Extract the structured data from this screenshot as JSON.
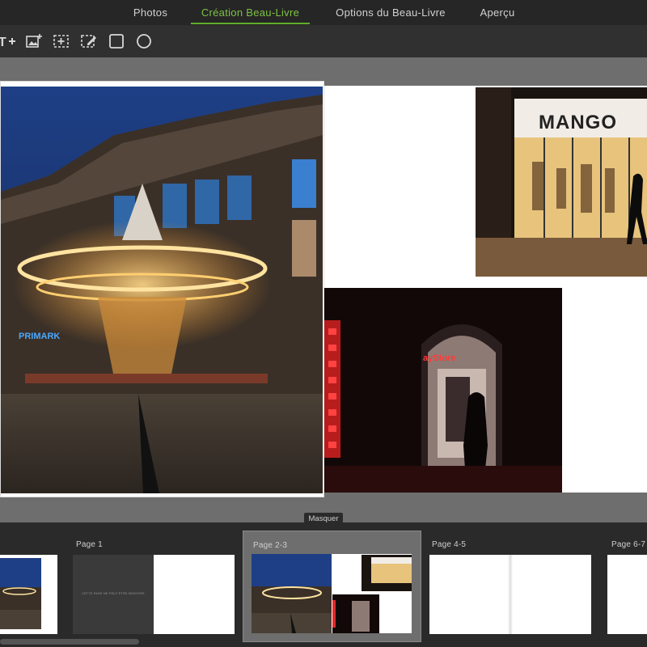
{
  "nav": {
    "tabs": [
      {
        "label": "Photos",
        "active": false
      },
      {
        "label": "Création Beau-Livre",
        "active": true
      },
      {
        "label": "Options du Beau-Livre",
        "active": false
      },
      {
        "label": "Aperçu",
        "active": false
      }
    ],
    "accent": "#7dc242"
  },
  "toolbar": {
    "tools": [
      "add-text-icon",
      "add-image-icon",
      "add-frame-icon",
      "edit-frame-icon",
      "rectangle-icon",
      "circle-icon"
    ]
  },
  "canvas": {
    "sign_text": "MANGO",
    "store_text": "PRIMARK",
    "bookstore_text": "ayStore"
  },
  "filmstrip": {
    "hide_label": "Masquer",
    "pages": [
      {
        "label": ""
      },
      {
        "label": "Page 1",
        "cover_text": "CETTE PAGE NE PEUT ÊTRE MODIFIÉE"
      },
      {
        "label": "Page 2-3",
        "selected": true
      },
      {
        "label": "Page 4-5"
      },
      {
        "label": "Page 6-7"
      }
    ]
  }
}
